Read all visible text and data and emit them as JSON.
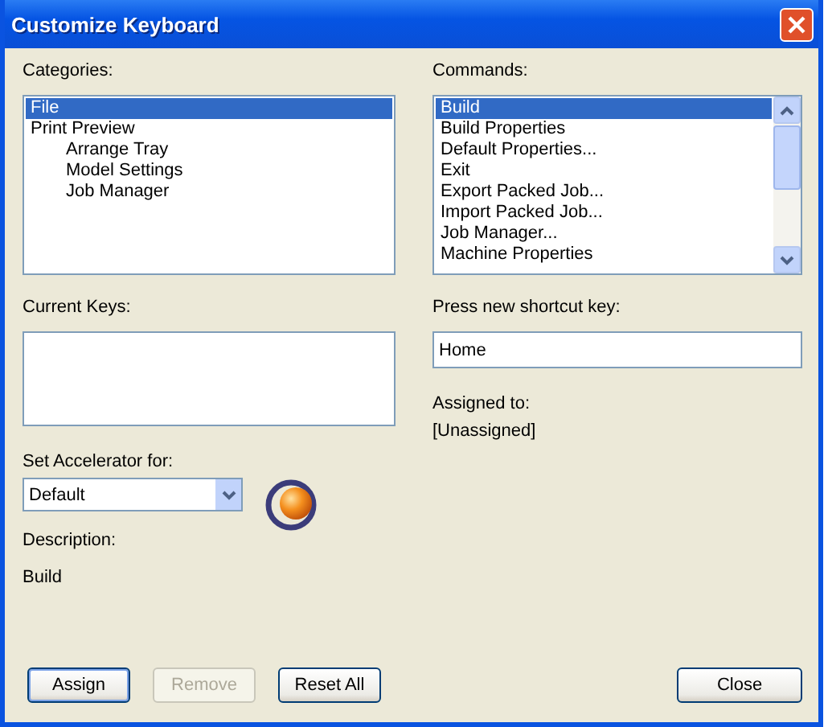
{
  "window": {
    "title": "Customize Keyboard"
  },
  "categories": {
    "label": "Categories:",
    "items": [
      {
        "label": "File",
        "selected": true
      },
      {
        "label": "Print Preview",
        "selected": false,
        "children": [
          {
            "label": "Arrange Tray",
            "selected": false
          },
          {
            "label": "Model Settings",
            "selected": false
          },
          {
            "label": "Job Manager",
            "selected": false
          }
        ]
      }
    ]
  },
  "commands": {
    "label": "Commands:",
    "items": [
      {
        "label": "Build",
        "selected": true
      },
      {
        "label": "Build Properties",
        "selected": false
      },
      {
        "label": "Default Properties...",
        "selected": false
      },
      {
        "label": "Exit",
        "selected": false
      },
      {
        "label": "Export Packed Job...",
        "selected": false
      },
      {
        "label": "Import Packed Job...",
        "selected": false
      },
      {
        "label": "Job Manager...",
        "selected": false
      },
      {
        "label": "Machine Properties",
        "selected": false
      }
    ]
  },
  "current_keys": {
    "label": "Current Keys:"
  },
  "shortcut": {
    "label": "Press new shortcut key:",
    "value": "Home"
  },
  "assigned": {
    "label": "Assigned to:",
    "value": "[Unassigned]"
  },
  "accelerator": {
    "label": "Set Accelerator for:",
    "value": "Default"
  },
  "description": {
    "label": "Description:",
    "value": "Build"
  },
  "buttons": [
    {
      "label": "Assign",
      "disabled": false,
      "kind": "left"
    },
    {
      "label": "Remove",
      "disabled": true,
      "kind": "left"
    },
    {
      "label": "Reset All",
      "disabled": false,
      "kind": "left"
    },
    {
      "label": "Close",
      "disabled": false,
      "kind": "right"
    }
  ]
}
